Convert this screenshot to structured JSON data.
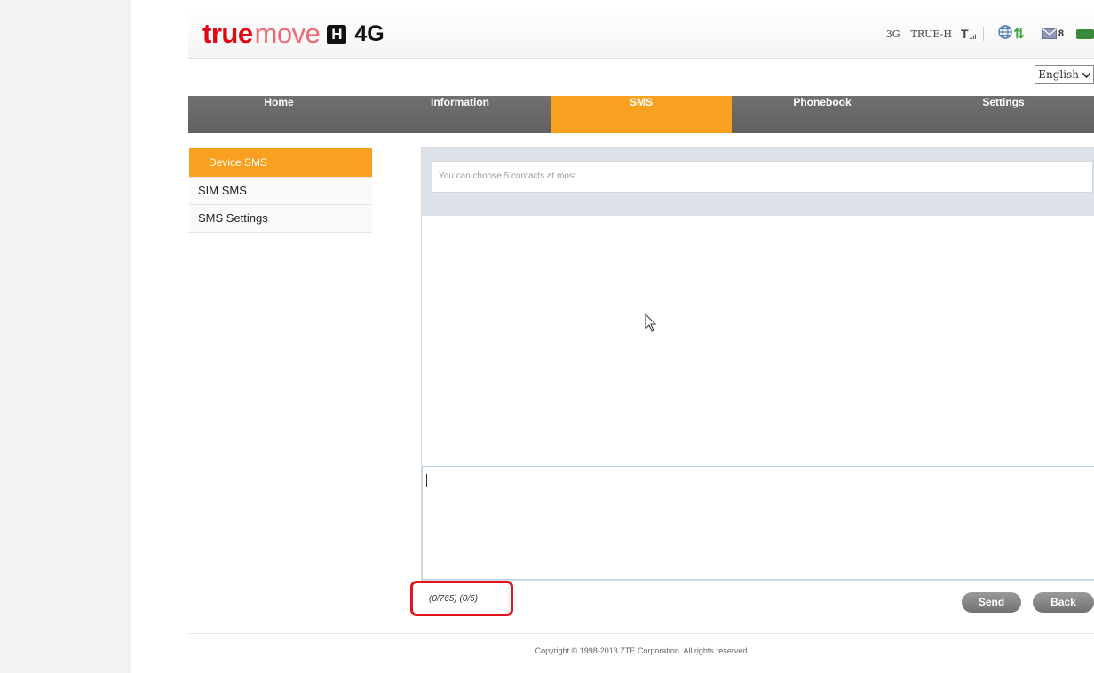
{
  "brand": {
    "true": "true",
    "move": "move",
    "h": "H",
    "network": "4G"
  },
  "status": {
    "network_type": "3G",
    "carrier": "TRUE-H",
    "signal_glyph": "T",
    "signal_bars": "..ıl",
    "arrows": "⇅",
    "sms_count": "8",
    "icons": [
      "signal-icon",
      "globe-icon",
      "mail-icon",
      "battery-icon"
    ]
  },
  "language": {
    "selected": "English"
  },
  "nav": {
    "items": [
      "Home",
      "Information",
      "SMS",
      "Phonebook",
      "Settings"
    ],
    "active": "SMS"
  },
  "sidebar": {
    "items": [
      {
        "label": "Device SMS",
        "active": true
      },
      {
        "label": "SIM SMS",
        "active": false
      },
      {
        "label": "SMS Settings",
        "active": false
      }
    ]
  },
  "compose": {
    "contact_placeholder": "You can choose 5 contacts at most",
    "message_value": "",
    "counter": "(0/765) (0/5)"
  },
  "buttons": {
    "send": "Send",
    "back": "Back"
  },
  "footer": {
    "copyright": "Copyright © 1998-2013 ZTE Corporation. All rights reserved"
  },
  "colors": {
    "accent": "#f8a01f",
    "nav_bg": "#6b6b6b",
    "brand_red": "#e30613",
    "highlight": "#e2151c"
  }
}
